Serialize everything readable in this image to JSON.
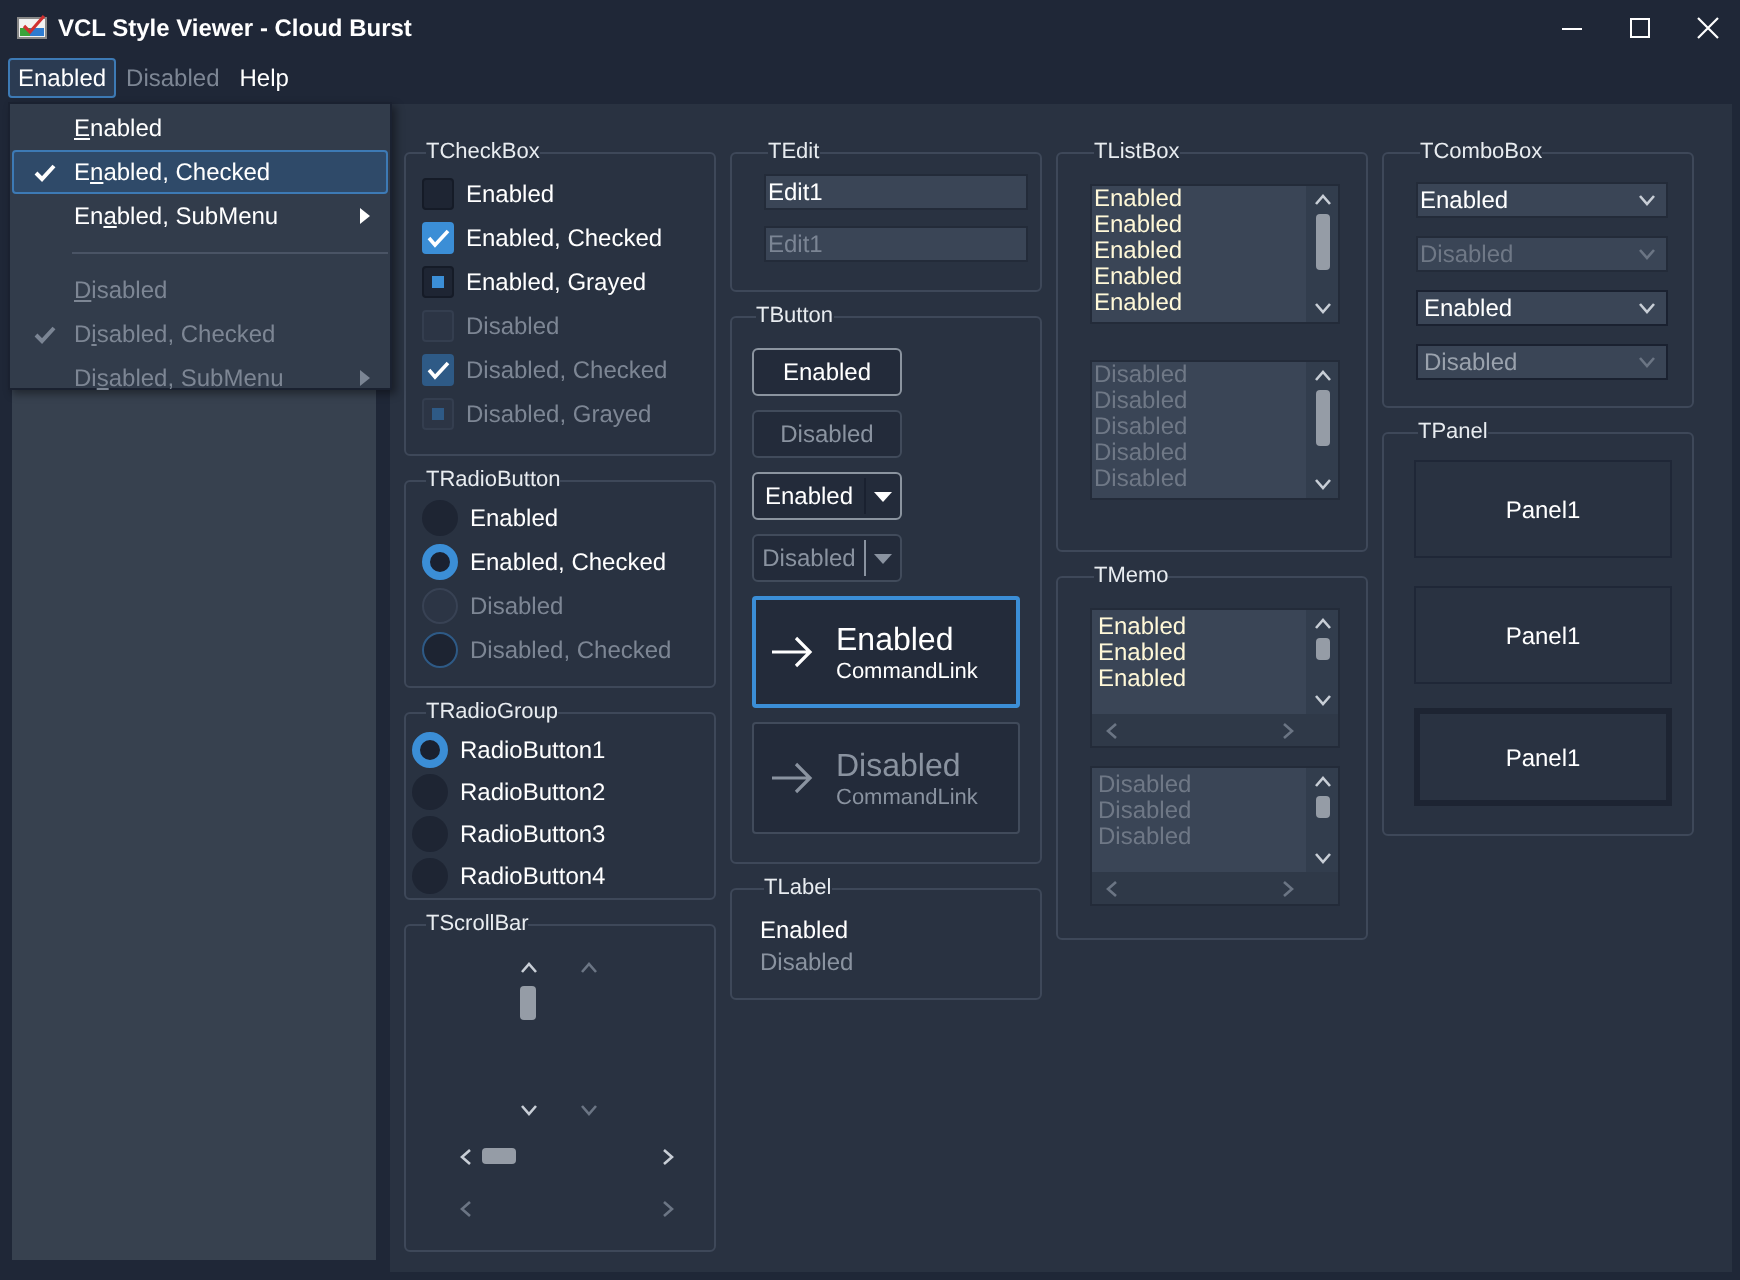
{
  "window": {
    "title": "VCL Style Viewer - Cloud Burst"
  },
  "menu_bar": [
    {
      "label": "Enabled",
      "selected": true,
      "disabled": false
    },
    {
      "label": "Disabled",
      "selected": false,
      "disabled": true
    },
    {
      "label": "Help",
      "selected": false,
      "disabled": false
    }
  ],
  "menu": {
    "items": [
      {
        "kind": "item",
        "accel": "E",
        "after": "nabled",
        "checked": false,
        "disabled": false,
        "selected": false,
        "submenu": false
      },
      {
        "kind": "item",
        "before": "E",
        "accel": "n",
        "after": "abled, Checked",
        "checked": true,
        "disabled": false,
        "selected": true,
        "submenu": false
      },
      {
        "kind": "item",
        "before": "En",
        "accel": "a",
        "after": "bled, SubMenu",
        "checked": false,
        "disabled": false,
        "selected": false,
        "submenu": true
      },
      {
        "kind": "separator"
      },
      {
        "kind": "item",
        "accel": "D",
        "after": "isabled",
        "checked": false,
        "disabled": true,
        "selected": false,
        "submenu": false
      },
      {
        "kind": "item",
        "before": "D",
        "accel": "i",
        "after": "sabled, Checked",
        "checked": true,
        "disabled": true,
        "selected": false,
        "submenu": false
      },
      {
        "kind": "item",
        "before": "Di",
        "accel": "s",
        "after": "abled, SubMenu",
        "checked": false,
        "disabled": true,
        "selected": false,
        "submenu": true
      }
    ]
  },
  "checkbox_group": {
    "title": "TCheckBox",
    "items": [
      {
        "label": "Enabled",
        "checked": false,
        "grayed": false,
        "disabled": false
      },
      {
        "label": "Enabled, Checked",
        "checked": true,
        "grayed": false,
        "disabled": false
      },
      {
        "label": "Enabled, Grayed",
        "checked": false,
        "grayed": true,
        "disabled": false
      },
      {
        "label": "Disabled",
        "checked": false,
        "grayed": false,
        "disabled": true
      },
      {
        "label": "Disabled, Checked",
        "checked": true,
        "grayed": false,
        "disabled": true
      },
      {
        "label": "Disabled, Grayed",
        "checked": false,
        "grayed": true,
        "disabled": true
      }
    ]
  },
  "radiobutton_group": {
    "title": "TRadioButton",
    "items": [
      {
        "label": "Enabled",
        "checked": false,
        "disabled": false
      },
      {
        "label": "Enabled, Checked",
        "checked": true,
        "disabled": false
      },
      {
        "label": "Disabled",
        "checked": false,
        "disabled": true
      },
      {
        "label": "Disabled, Checked",
        "checked": true,
        "disabled": true
      }
    ]
  },
  "radio_group": {
    "title": "TRadioGroup",
    "items": [
      {
        "label": "RadioButton1",
        "selected": true
      },
      {
        "label": "RadioButton2",
        "selected": false
      },
      {
        "label": "RadioButton3",
        "selected": false
      },
      {
        "label": "RadioButton4",
        "selected": false
      }
    ]
  },
  "scrollbar_group": {
    "title": "TScrollBar",
    "vertical_scrollbars": [
      {
        "disabled": false
      },
      {
        "disabled": true
      }
    ],
    "horizontal_scrollbars": [
      {
        "disabled": false
      },
      {
        "disabled": true
      }
    ]
  },
  "edit_group": {
    "title": "TEdit",
    "fields": [
      {
        "value": "Edit1",
        "disabled": false
      },
      {
        "value": "Edit1",
        "disabled": true
      }
    ]
  },
  "button_group": {
    "title": "TButton",
    "buttons": [
      {
        "kind": "push",
        "label": "Enabled",
        "disabled": false
      },
      {
        "kind": "push",
        "label": "Disabled",
        "disabled": true
      },
      {
        "kind": "split",
        "label": "Enabled",
        "disabled": false
      },
      {
        "kind": "split",
        "label": "Disabled",
        "disabled": true
      },
      {
        "kind": "command_link",
        "label": "Enabled",
        "note": "CommandLink",
        "disabled": false,
        "focused": true
      },
      {
        "kind": "command_link",
        "label": "Disabled",
        "note": "CommandLink",
        "disabled": true,
        "focused": false
      }
    ]
  },
  "label_group": {
    "title": "TLabel",
    "labels": [
      {
        "text": "Enabled",
        "disabled": false
      },
      {
        "text": "Disabled",
        "disabled": true
      }
    ]
  },
  "listbox_group": {
    "title": "TListBox",
    "listboxes": [
      {
        "disabled": false,
        "items": [
          "Enabled",
          "Enabled",
          "Enabled",
          "Enabled",
          "Enabled"
        ]
      },
      {
        "disabled": true,
        "items": [
          "Disabled",
          "Disabled",
          "Disabled",
          "Disabled",
          "Disabled"
        ]
      }
    ]
  },
  "memo_group": {
    "title": "TMemo",
    "memos": [
      {
        "disabled": false,
        "lines": [
          "Enabled",
          "Enabled",
          "Enabled"
        ]
      },
      {
        "disabled": true,
        "lines": [
          "Disabled",
          "Disabled",
          "Disabled"
        ]
      }
    ]
  },
  "combobox_group": {
    "title": "TComboBox",
    "comboboxes": [
      {
        "kind": "dropdown",
        "value": "Enabled",
        "disabled": false
      },
      {
        "kind": "dropdown",
        "value": "Disabled",
        "disabled": true
      },
      {
        "kind": "dropdown_list",
        "value": "Enabled",
        "disabled": false
      },
      {
        "kind": "dropdown_list",
        "value": "Disabled",
        "disabled": true
      }
    ]
  },
  "panel_group": {
    "title": "TPanel",
    "panels": [
      {
        "kind": "single",
        "label": "Panel1"
      },
      {
        "kind": "single",
        "label": "Panel1"
      },
      {
        "kind": "double",
        "label": "Panel1"
      }
    ]
  }
}
